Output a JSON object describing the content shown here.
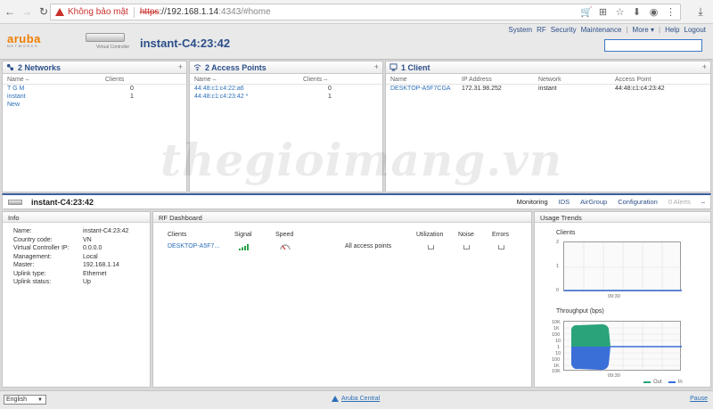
{
  "browser": {
    "security_label": "Không bảo mật",
    "url_scheme": "https",
    "url_host": "://192.168.1.14",
    "url_rest": ":4343/#home"
  },
  "header": {
    "logo_text": "aruba",
    "logo_sub": "NETWORKS",
    "vc_label": "Virtual Controller",
    "title": "instant-C4:23:42",
    "nav": [
      "System",
      "RF",
      "Security",
      "Maintenance",
      "More ▾",
      "Help",
      "Logout"
    ]
  },
  "networks": {
    "title": "2 Networks",
    "col_name": "Name –",
    "col_clients": "Clients",
    "rows": [
      {
        "name": "T G M",
        "clients": "0"
      },
      {
        "name": "instant",
        "clients": "1"
      }
    ],
    "new_label": "New"
  },
  "access_points": {
    "title": "2 Access Points",
    "col_name": "Name –",
    "col_clients": "Clients –",
    "rows": [
      {
        "name": "44:48:c1:c4:22:a6",
        "clients": "0"
      },
      {
        "name": "44:48:c1:c4:23:42 *",
        "clients": "1"
      }
    ]
  },
  "clients": {
    "title": "1 Client",
    "col_name": "Name",
    "col_ip": "IP Address",
    "col_network": "Network",
    "col_ap": "Access Point",
    "rows": [
      {
        "name": "DESKTOP-A5F7CGA",
        "ip": "172.31.98.252",
        "network": "instant",
        "ap": "44:48:c1:c4:23:42"
      }
    ]
  },
  "device": {
    "title": "instant-C4:23:42",
    "tabs": [
      "Monitoring",
      "IDS",
      "AirGroup",
      "Configuration",
      "0 Alerts",
      "–"
    ]
  },
  "info": {
    "title": "Info",
    "rows": [
      {
        "k": "Name:",
        "v": "instant-C4:23:42"
      },
      {
        "k": "Country code:",
        "v": "VN"
      },
      {
        "k": "Virtual Controller IP:",
        "v": "0.0.0.0"
      },
      {
        "k": "Management:",
        "v": "Local"
      },
      {
        "k": "Master:",
        "v": "192.168.1.14"
      },
      {
        "k": "Uplink type:",
        "v": "Ethernet"
      },
      {
        "k": "Uplink status:",
        "v": "Up"
      }
    ]
  },
  "rf": {
    "title": "RF Dashboard",
    "cols": {
      "clients": "Clients",
      "signal": "Signal",
      "speed": "Speed",
      "utilization": "Utilization",
      "noise": "Noise",
      "errors": "Errors"
    },
    "client_row": "DESKTOP-A5F7...",
    "ap_row": "All access points"
  },
  "trends": {
    "title": "Usage Trends",
    "clients_label": "Clients",
    "clients_ticks": [
      "2",
      "1",
      "0"
    ],
    "clients_time": "09:30",
    "throughput_label": "Throughput   (bps)",
    "throughput_ticks": [
      "10K",
      "1K",
      "100",
      "10",
      "1",
      "10",
      "100",
      "1K",
      "10K"
    ],
    "throughput_time": "09:30",
    "legend_out": "Out",
    "legend_in": "In",
    "color_out": "#2aa37a",
    "color_in": "#3a6fd8"
  },
  "footer": {
    "language": "English",
    "central": "Aruba Central",
    "pause": "Pause"
  },
  "watermark": "thegioimang.vn"
}
